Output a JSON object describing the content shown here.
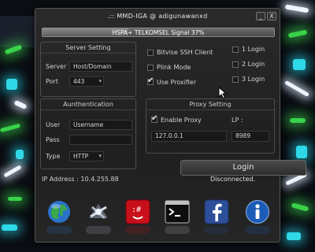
{
  "window": {
    "title": ".:: MMD-IGA @ adigunawanxd",
    "minimize": "_",
    "close": "X"
  },
  "signal": {
    "text": "HSPA+ TELKOMSEL Signal 37%",
    "level": 0.37
  },
  "server": {
    "title": "Server Setting",
    "server_label": "Server",
    "server_value": "Host/Domain",
    "port_label": "Port",
    "port_value": "443"
  },
  "auth": {
    "title": "Aunthentication",
    "user_label": "User",
    "user_value": "Username",
    "pass_label": "Pass",
    "pass_value": "",
    "type_label": "Type",
    "type_value": "HTTP"
  },
  "options": [
    {
      "label": "Bitvise SSH Client",
      "checked": false
    },
    {
      "label": "Plink Mode",
      "checked": false
    },
    {
      "label": "Use Proxifier",
      "checked": true
    }
  ],
  "logins": [
    {
      "label": "1 Login",
      "checked": false
    },
    {
      "label": "2 Login",
      "checked": false
    },
    {
      "label": "3 Login",
      "checked": false
    }
  ],
  "proxy": {
    "title": "Proxy Setting",
    "enable_label": "Enable Proxy",
    "enable_checked": true,
    "lp_label": "LP :",
    "ip_value": "127.0.0.1",
    "port_value": "8989"
  },
  "login_button": "Login",
  "ip_address": "IP Address : 10.4.255.88",
  "status": "Disconnected.",
  "toolbar_icons": [
    "globe-icon",
    "network-icon",
    "terminal-hash-icon",
    "console-icon",
    "facebook-icon",
    "info-icon"
  ],
  "colors": {
    "accent_blue": "#1d5bb8",
    "terminal_red": "#c8101a",
    "facebook_blue": "#2d4f9a"
  }
}
